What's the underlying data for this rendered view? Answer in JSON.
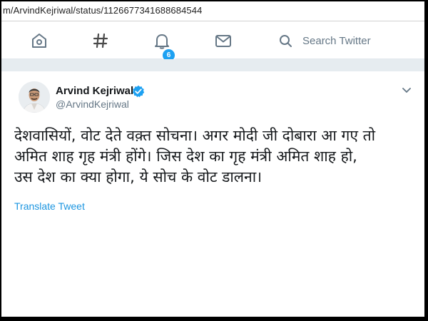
{
  "browser": {
    "url": "m/ArvindKejriwal/status/1126677341688684544"
  },
  "nav": {
    "items": [
      {
        "icon": "home-icon"
      },
      {
        "icon": "hashtag-icon"
      },
      {
        "icon": "bell-icon",
        "badge": "6"
      },
      {
        "icon": "mail-icon"
      }
    ],
    "search_placeholder": "Search Twitter"
  },
  "tweet": {
    "author_name": "Arvind Kejriwal",
    "handle": "@ArvindKejriwal",
    "verified": true,
    "text_lines": [
      "देशवासियों, वोट देते वक़्त सोचना। अगर मोदी जी दोबारा आ गए तो",
      "अमित शाह गृह मंत्री होंगे। जिस देश का गृह मंत्री अमित शाह हो,",
      "उस देश का क्या होगा, ये सोच के वोट डालना।"
    ],
    "translate_label": "Translate Tweet"
  },
  "colors": {
    "accent": "#1da1f2",
    "link": "#1b95e0",
    "secondary_text": "#657786"
  }
}
